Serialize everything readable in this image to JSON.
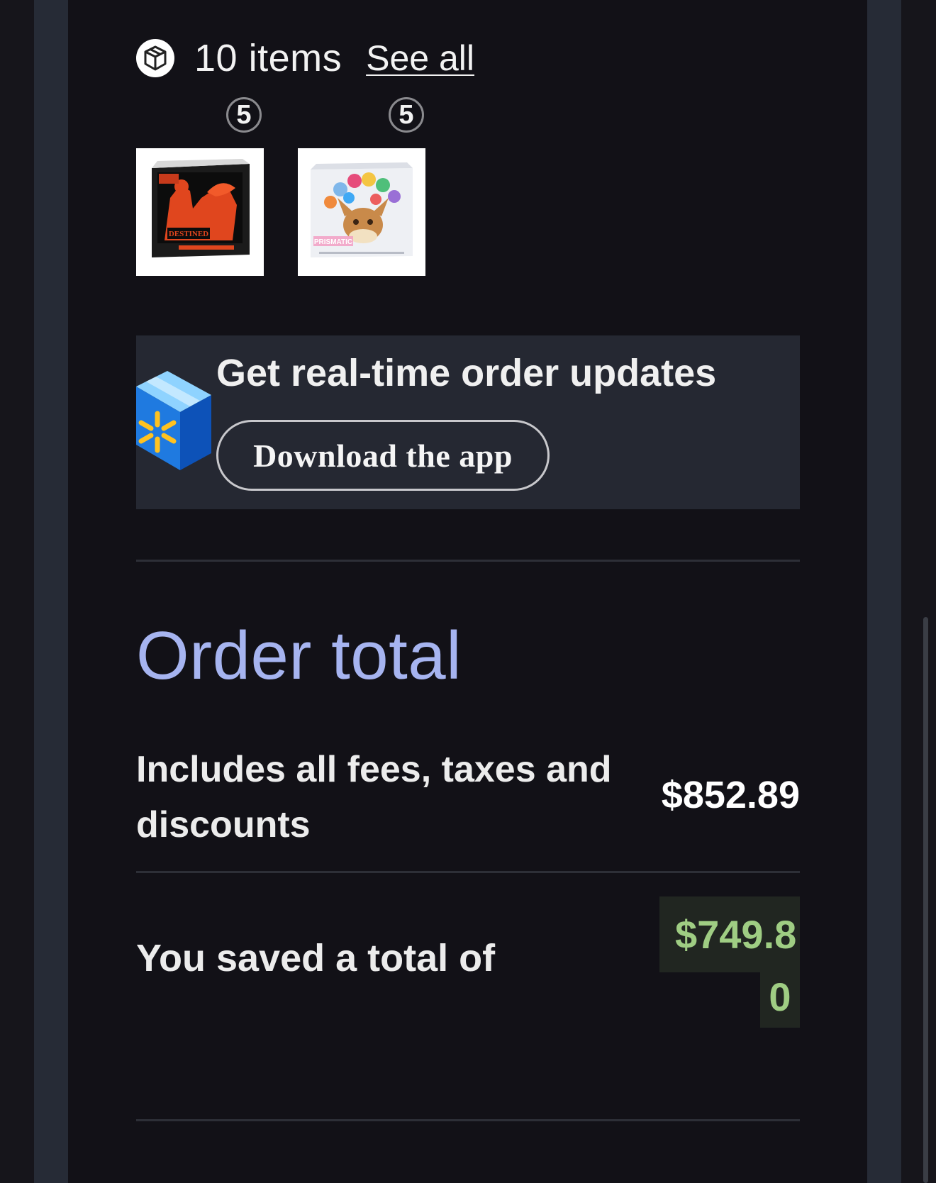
{
  "items": {
    "count_label": "10 items",
    "see_all_label": "See all",
    "icon": "package-box-icon"
  },
  "products": [
    {
      "quantity": "5",
      "name": "Destined Rivals Elite Trainer Box"
    },
    {
      "quantity": "5",
      "name": "Prismatic Evolutions Elite Trainer Box"
    }
  ],
  "promo": {
    "title": "Get real-time order updates",
    "button_label": "Download the app",
    "icon": "walmart-box-icon"
  },
  "order_total": {
    "title": "Order total",
    "fees_label": "Includes all fees, taxes and discounts",
    "total_value": "$852.89",
    "saved_label": "You saved a total of",
    "saved_value_line1": "$749.8",
    "saved_value_line2": "0"
  },
  "colors": {
    "background": "#121117",
    "rail": "#262b36",
    "banner": "#252832",
    "order_total_title": "#a6b4f0",
    "savings_text": "#9fcd83",
    "savings_bg": "#212621"
  }
}
